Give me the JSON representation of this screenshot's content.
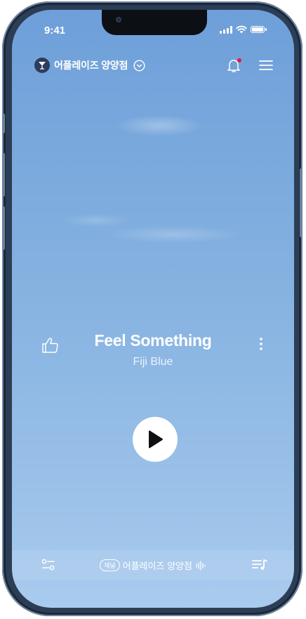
{
  "status_bar": {
    "time": "9:41"
  },
  "header": {
    "store_name": "어플레이즈 양양점"
  },
  "track": {
    "title": "Feel Something",
    "artist": "Fiji Blue"
  },
  "bottom_bar": {
    "channel_badge": "채널",
    "channel_name": "어플레이즈 양양점"
  },
  "icons": {
    "logo": "cocktail-logo-icon",
    "dropdown": "chevron-down-circle-icon",
    "notification": "bell-icon",
    "menu": "hamburger-menu-icon",
    "like": "thumbs-up-icon",
    "more": "vertical-dots-icon",
    "play": "play-icon",
    "filter": "sliders-icon",
    "equalizer": "sound-wave-icon",
    "queue": "playlist-icon"
  },
  "colors": {
    "notification_dot": "#e8174b",
    "sky_top": "#6e9fd9",
    "sky_bottom": "#a9cbee"
  }
}
